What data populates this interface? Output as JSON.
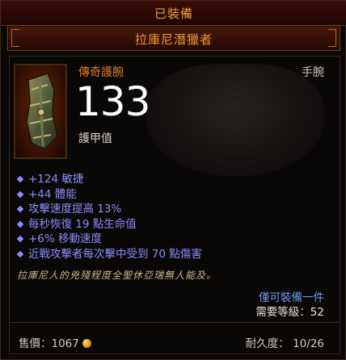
{
  "status": {
    "label": "已裝備"
  },
  "item": {
    "name": "拉庫尼潛獵者",
    "type": "傳奇護腕",
    "slot": "手腕",
    "armor_value": "133",
    "armor_label": "護甲值",
    "icon": "bracers-icon",
    "affixes": [
      "+124 敏捷",
      "+44 體能",
      "攻擊速度提高 13%",
      "每秒恢復 19 點生命值",
      "+6% 移動速度",
      "近戰攻擊者每次擊中受到 70 點傷害"
    ],
    "flavor_text": "拉庫尼人的兇殘程度全聖休亞瑞無人能及。",
    "unique_equipped": "僅可裝備一件",
    "required_level": "需要等級：52",
    "sell_price": "售價：1067",
    "durability": "耐久度： 10/26"
  },
  "colors": {
    "legendary": "#f09a36",
    "magic_affix": "#8c8cff",
    "unique_equipped": "#6e9cf0",
    "status_header": "#e8a43a"
  }
}
